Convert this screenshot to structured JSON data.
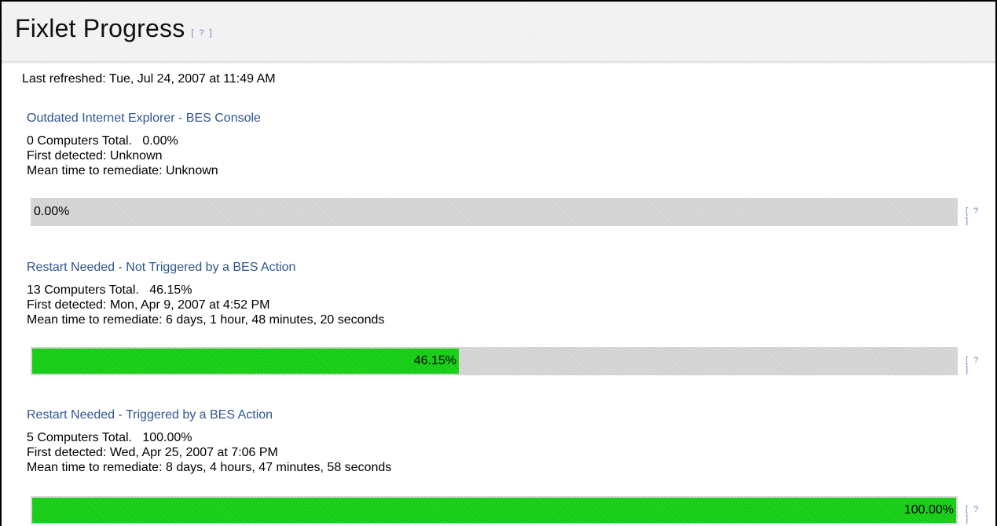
{
  "header": {
    "title": "Fixlet Progress",
    "help_label": "[ ? ]"
  },
  "last_refreshed": "Last refreshed: Tue, Jul 24, 2007 at 11:49 AM",
  "fixlets": [
    {
      "title": "Outdated Internet Explorer - BES Console",
      "total": "0 Computers Total.   0.00%",
      "first_detected": "First detected: Unknown",
      "mean_time": "Mean time to remediate: Unknown",
      "progress_label": "0.00%",
      "progress": 0.0,
      "help_label": "[ ? ]"
    },
    {
      "title": "Restart Needed - Not Triggered by a BES Action",
      "total": "13 Computers Total.   46.15%",
      "first_detected": "First detected: Mon, Apr 9, 2007 at 4:52 PM",
      "mean_time": "Mean time to remediate: 6 days, 1 hour, 48 minutes, 20 seconds",
      "progress_label": "46.15%",
      "progress": 0.4615,
      "help_label": "[ ? ]"
    },
    {
      "title": "Restart Needed - Triggered by a BES Action",
      "total": "5 Computers Total.   100.00%",
      "first_detected": "First detected: Wed, Apr 25, 2007 at 7:06 PM",
      "mean_time": "Mean time to remediate: 8 days, 4 hours, 47 minutes, 58 seconds",
      "progress_label": "100.00%",
      "progress": 1.0,
      "help_label": "[ ? ]"
    }
  ]
}
